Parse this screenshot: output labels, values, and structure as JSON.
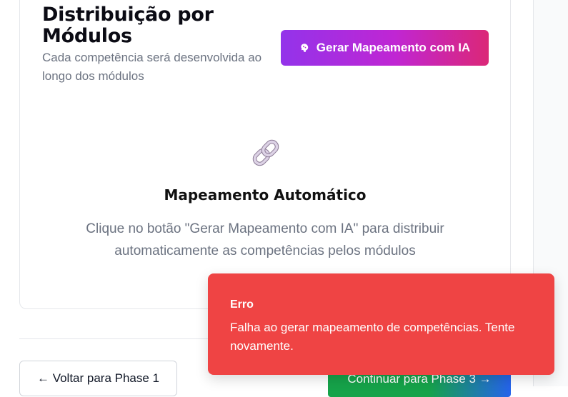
{
  "section": {
    "title": "Distribuição por Módulos",
    "subtitle": "Cada competência será desenvolvida ao longo dos módulos",
    "ai_button_label": "Gerar Mapeamento com IA",
    "ai_button_icon": "brain-icon",
    "gradient_colors": [
      "#9333ea",
      "#db2777"
    ]
  },
  "empty_state": {
    "icon": "link-icon",
    "title": "Mapeamento Automático",
    "description": "Clique no botão \"Gerar Mapeamento com IA\" para distribuir automaticamente as competências pelos módulos"
  },
  "navigation": {
    "back_label": "← Voltar para Phase 1",
    "continue_label": "Continuar para Phase 3 →",
    "continue_colors": [
      "#16a34a",
      "#2563eb"
    ]
  },
  "toast": {
    "title": "Erro",
    "message": "Falha ao gerar mapeamento de competências. Tente novamente.",
    "color": "#ef4444"
  }
}
